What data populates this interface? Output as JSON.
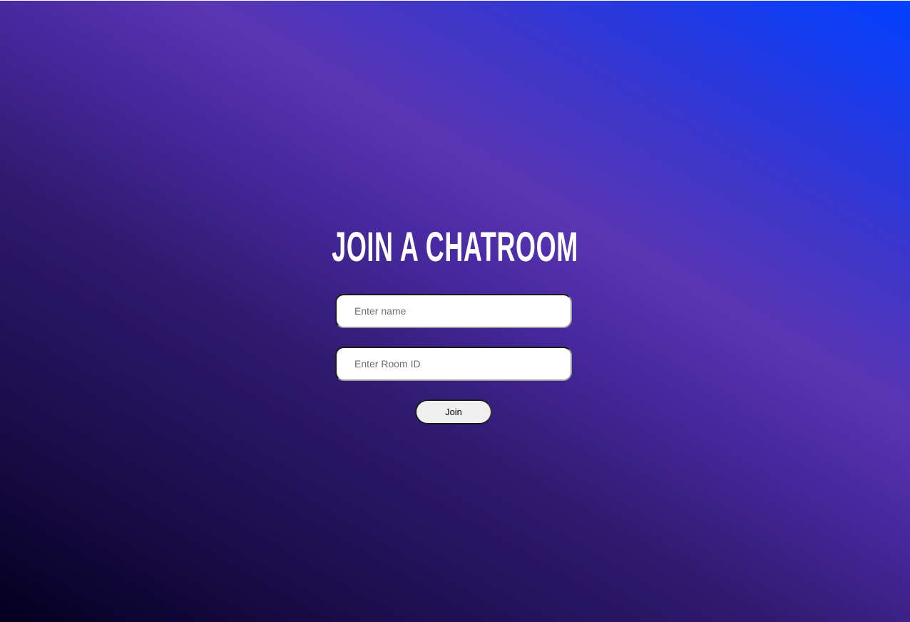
{
  "page": {
    "title": "JOIN A CHATROOM"
  },
  "form": {
    "name_placeholder": "Enter name",
    "name_value": "",
    "room_placeholder": "Enter Room ID",
    "room_value": "",
    "join_label": "Join"
  },
  "colors": {
    "background_dark": "#04001f",
    "background_mid": "#5a36b3",
    "background_light": "#0040ff",
    "title_text": "#ffffff",
    "input_background": "#ffffff",
    "button_background": "#efefef"
  }
}
